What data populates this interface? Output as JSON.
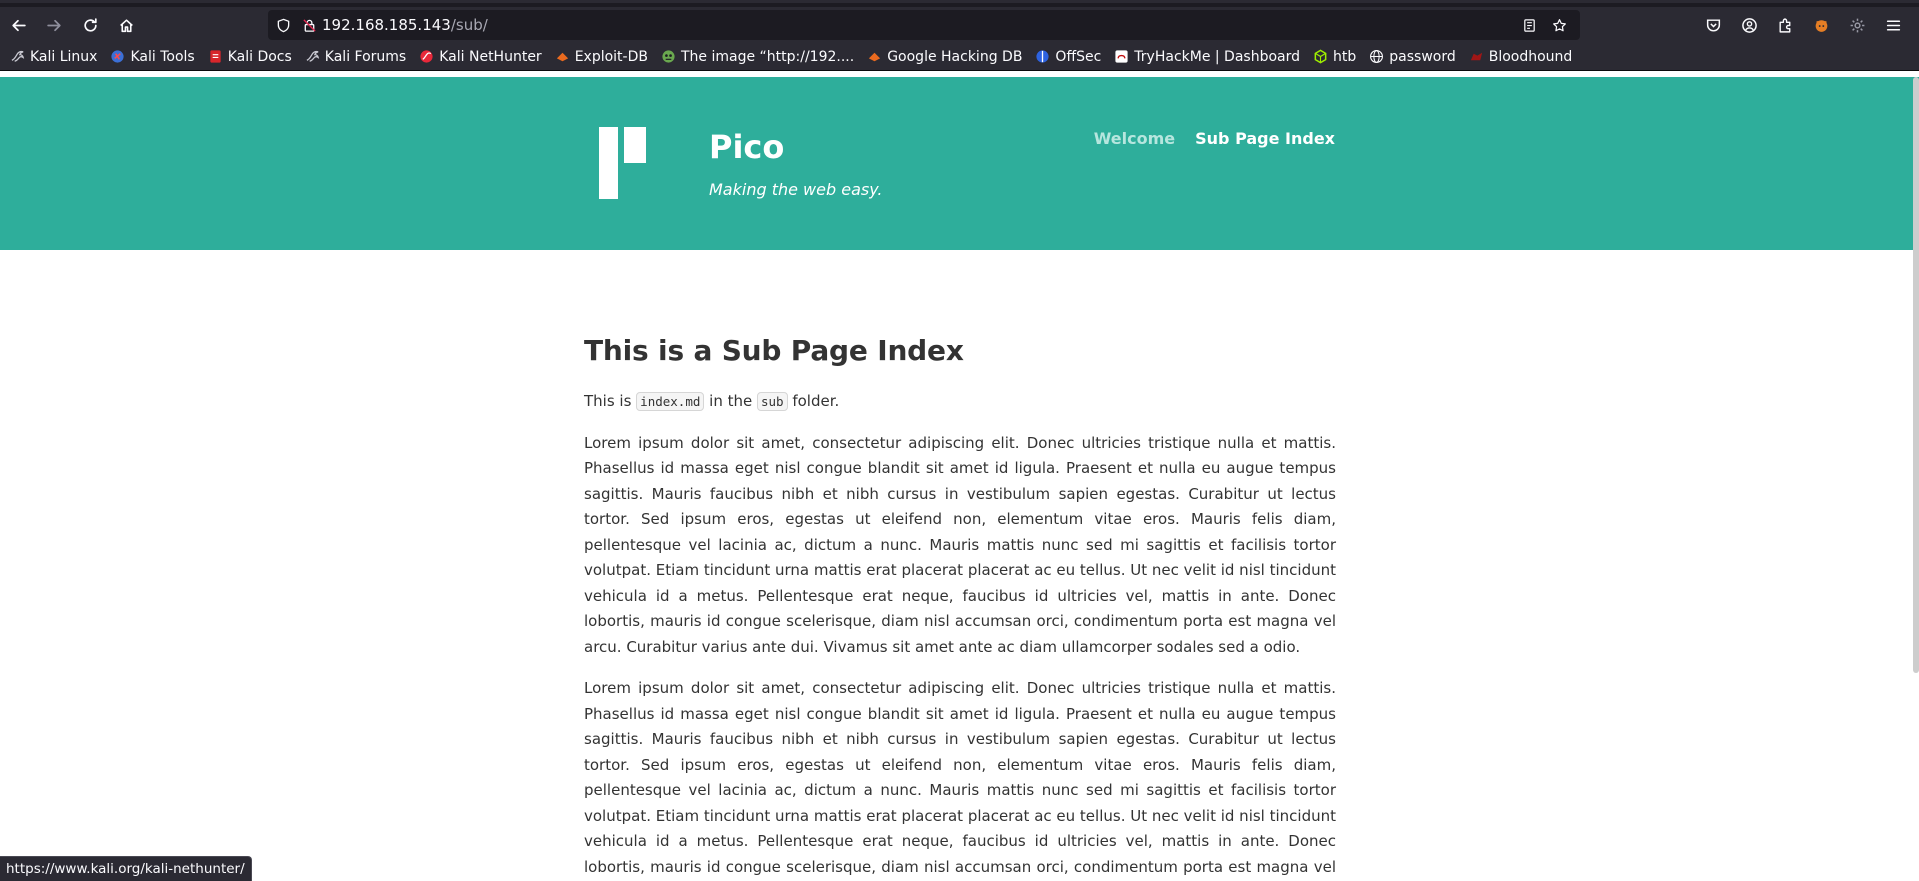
{
  "browser": {
    "url_host": "192.168.185.143",
    "url_path": "/sub/",
    "status_url": "https://www.kali.org/kali-nethunter/"
  },
  "bookmarks": [
    {
      "label": "Kali Linux",
      "icon": "kali-dragon-icon"
    },
    {
      "label": "Kali Tools",
      "icon": "kali-tools-icon"
    },
    {
      "label": "Kali Docs",
      "icon": "kali-docs-icon"
    },
    {
      "label": "Kali Forums",
      "icon": "kali-dragon-icon"
    },
    {
      "label": "Kali NetHunter",
      "icon": "nethunter-icon"
    },
    {
      "label": "Exploit-DB",
      "icon": "exploit-db-icon"
    },
    {
      "label": "The image “http://192....",
      "icon": "image-icon"
    },
    {
      "label": "Google Hacking DB",
      "icon": "ghdb-icon"
    },
    {
      "label": "OffSec",
      "icon": "offsec-icon"
    },
    {
      "label": "TryHackMe | Dashboard",
      "icon": "tryhackme-icon"
    },
    {
      "label": "htb",
      "icon": "htb-icon"
    },
    {
      "label": "password",
      "icon": "globe-icon"
    },
    {
      "label": "Bloodhound",
      "icon": "bloodhound-icon"
    }
  ],
  "site": {
    "title": "Pico",
    "tagline": "Making the web easy.",
    "nav": [
      {
        "label": "Welcome",
        "active": false
      },
      {
        "label": "Sub Page Index",
        "active": true
      }
    ]
  },
  "content": {
    "heading": "This is a Sub Page Index",
    "intro_prefix": "This is ",
    "intro_code1": "index.md",
    "intro_mid": " in the ",
    "intro_code2": "sub",
    "intro_suffix": " folder.",
    "paragraphs": [
      "Lorem ipsum dolor sit amet, consectetur adipiscing elit. Donec ultricies tristique nulla et mattis. Phasellus id massa eget nisl congue blandit sit amet id ligula. Praesent et nulla eu augue tempus sagittis. Mauris faucibus nibh et nibh cursus in vestibulum sapien egestas. Curabitur ut lectus tortor. Sed ipsum eros, egestas ut eleifend non, elementum vitae eros. Mauris felis diam, pellentesque vel lacinia ac, dictum a nunc. Mauris mattis nunc sed mi sagittis et facilisis tortor volutpat. Etiam tincidunt urna mattis erat placerat placerat ac eu tellus. Ut nec velit id nisl tincidunt vehicula id a metus. Pellentesque erat neque, faucibus id ultricies vel, mattis in ante. Donec lobortis, mauris id congue scelerisque, diam nisl accumsan orci, condimentum porta est magna vel arcu. Curabitur varius ante dui. Vivamus sit amet ante ac diam ullamcorper sodales sed a odio.",
      "Lorem ipsum dolor sit amet, consectetur adipiscing elit. Donec ultricies tristique nulla et mattis. Phasellus id massa eget nisl congue blandit sit amet id ligula. Praesent et nulla eu augue tempus sagittis. Mauris faucibus nibh et nibh cursus in vestibulum sapien egestas. Curabitur ut lectus tortor. Sed ipsum eros, egestas ut eleifend non, elementum vitae eros. Mauris felis diam, pellentesque vel lacinia ac, dictum a nunc. Mauris mattis nunc sed mi sagittis et facilisis tortor volutpat. Etiam tincidunt urna mattis erat placerat placerat ac eu tellus. Ut nec velit id nisl tincidunt vehicula id a metus. Pellentesque erat neque, faucibus id ultricies vel, mattis in ante. Donec lobortis, mauris id congue scelerisque, diam nisl accumsan orci, condimentum porta est magna vel arcu. Curabitur varius ante dui. Vivamus sit amet ante"
    ]
  },
  "colors": {
    "hero_bg": "#2eae9b",
    "chrome_bg": "#2b2a33",
    "text": "#333333"
  }
}
